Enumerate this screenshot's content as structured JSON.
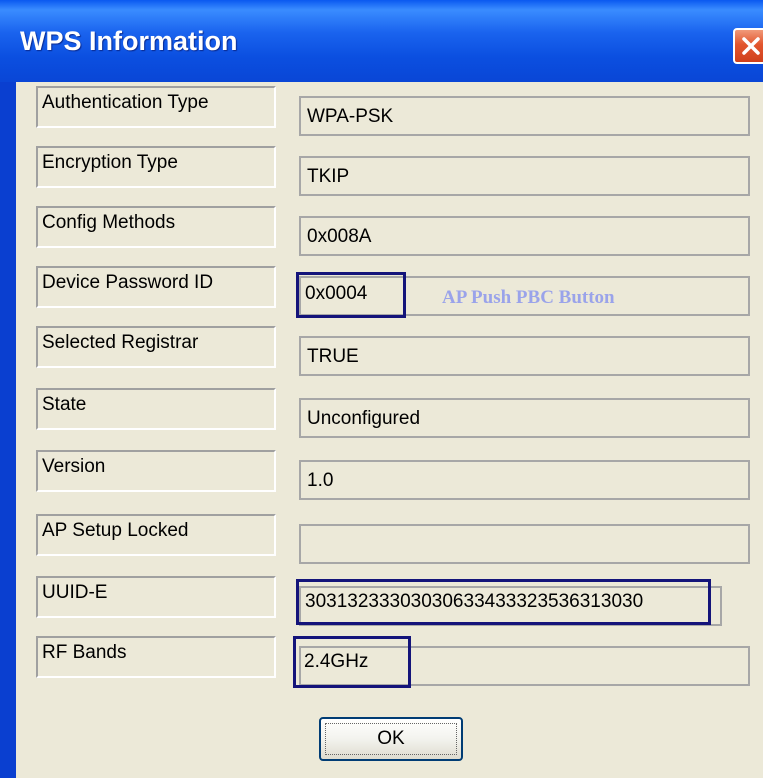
{
  "window": {
    "title": "WPS Information"
  },
  "fields": [
    {
      "label": "Authentication Type",
      "value": "WPA-PSK"
    },
    {
      "label": "Encryption Type",
      "value": "TKIP"
    },
    {
      "label": "Config Methods",
      "value": "0x008A"
    },
    {
      "label": "Device Password ID",
      "value": "0x0004"
    },
    {
      "label": "Selected Registrar",
      "value": "TRUE"
    },
    {
      "label": "State",
      "value": "Unconfigured"
    },
    {
      "label": "Version",
      "value": "1.0"
    },
    {
      "label": "AP Setup Locked",
      "value": ""
    },
    {
      "label": "UUID-E",
      "value": "30313233303030633433323536313030"
    },
    {
      "label": "RF Bands",
      "value": "2.4GHz"
    }
  ],
  "annotation": "AP Push PBC Button",
  "buttons": {
    "ok_label": "OK"
  },
  "colors": {
    "titlebar": "#0b4fe0",
    "highlight_border": "#14147a",
    "annotation": "#9aa3ea",
    "dialog_bg": "#ece9d8"
  }
}
